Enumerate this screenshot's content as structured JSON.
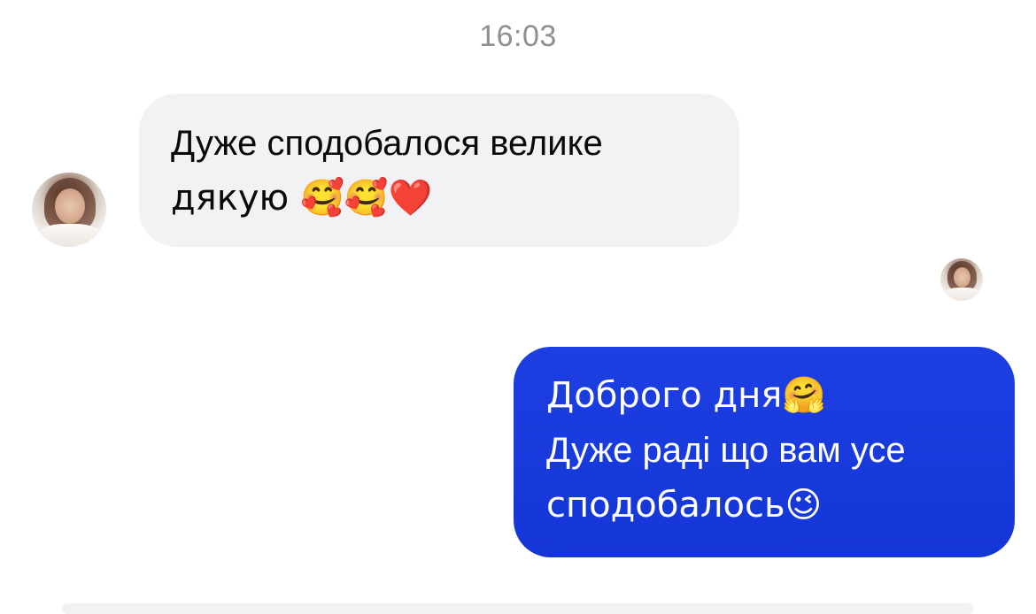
{
  "conversation": {
    "timestamp": "16:03",
    "messages": [
      {
        "direction": "incoming",
        "lines": [
          "Дуже сподобалося велике",
          "дякую 🥰🥰❤️"
        ]
      },
      {
        "direction": "outgoing",
        "lines": [
          "Доброго дня🤗",
          "Дуже раді що вам усе",
          "сподобалось😉"
        ]
      }
    ]
  },
  "colors": {
    "incoming_bubble": "#f2f2f5",
    "outgoing_bubble": "#1a3ade",
    "timestamp_text": "#8e8e93"
  },
  "icons": {
    "sender_avatar": "profile-photo",
    "read_receipt_avatar": "profile-photo"
  }
}
